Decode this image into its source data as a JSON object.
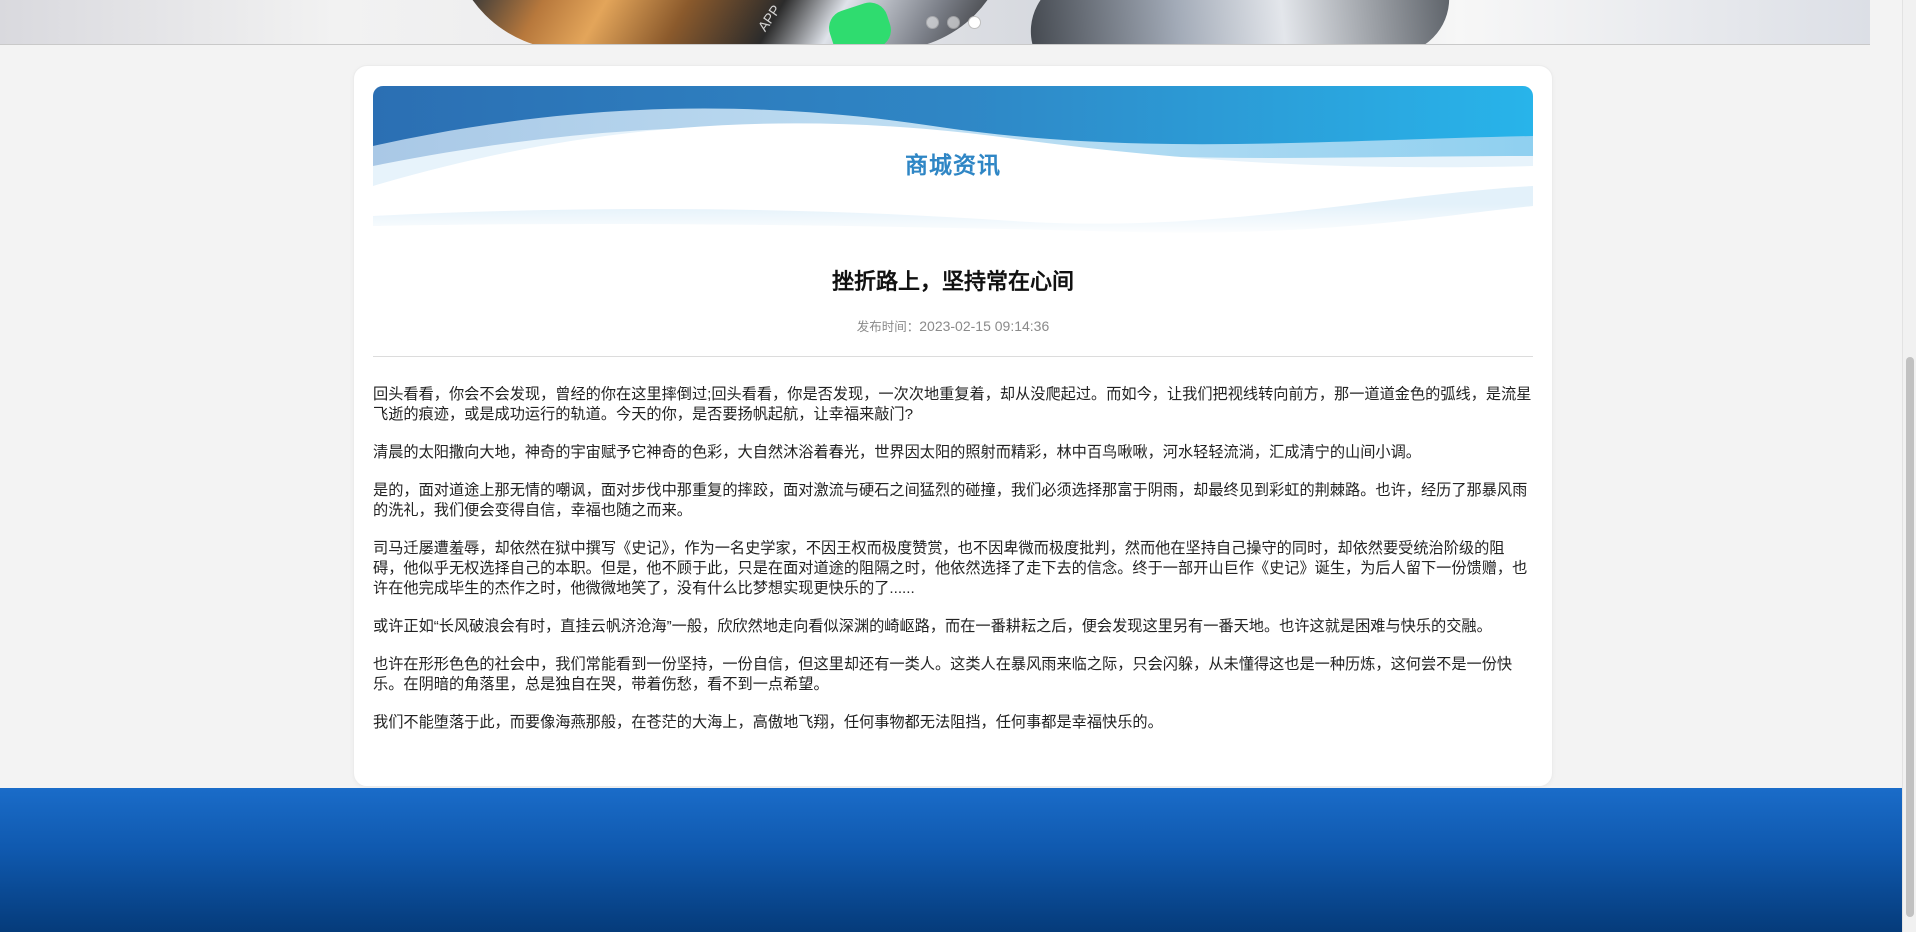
{
  "banner": {
    "app_text": "APP",
    "dots": [
      {
        "state": "inactive"
      },
      {
        "state": "inactive"
      },
      {
        "state": "active"
      }
    ]
  },
  "section": {
    "title": "商城资讯"
  },
  "article": {
    "title": "挫折路上，坚持常在心间",
    "publish_label": "发布时间：",
    "publish_time": "2023-02-15 09:14:36",
    "paragraphs": [
      "回头看看，你会不会发现，曾经的你在这里摔倒过;回头看看，你是否发现，一次次地重复着，却从没爬起过。而如今，让我们把视线转向前方，那一道道金色的弧线，是流星飞逝的痕迹，或是成功运行的轨道。今天的你，是否要扬帆起航，让幸福来敲门?",
      "清晨的太阳撒向大地，神奇的宇宙赋予它神奇的色彩，大自然沐浴着春光，世界因太阳的照射而精彩，林中百鸟啾啾，河水轻轻流淌，汇成清宁的山间小调。",
      "是的，面对道途上那无情的嘲讽，面对步伐中那重复的摔跤，面对激流与硬石之间猛烈的碰撞，我们必须选择那富于阴雨，却最终见到彩虹的荆棘路。也许，经历了那暴风雨的洗礼，我们便会变得自信，幸福也随之而来。",
      "司马迁屡遭羞辱，却依然在狱中撰写《史记》，作为一名史学家，不因王权而极度赞赏，也不因卑微而极度批判，然而他在坚持自己操守的同时，却依然要受统治阶级的阻碍，他似乎无权选择自己的本职。但是，他不顾于此，只是在面对道途的阻隔之时，他依然选择了走下去的信念。终于一部开山巨作《史记》诞生，为后人留下一份馈赠，也许在他完成毕生的杰作之时，他微微地笑了，没有什么比梦想实现更快乐的了......",
      "或许正如“长风破浪会有时，直挂云帆济沧海”一般，欣欣然地走向看似深渊的崎岖路，而在一番耕耘之后，便会发现这里另有一番天地。也许这就是困难与快乐的交融。",
      "也许在形形色色的社会中，我们常能看到一份坚持，一份自信，但这里却还有一类人。这类人在暴风雨来临之际，只会闪躲，从未懂得这也是一种历炼，这何尝不是一份快乐。在阴暗的角落里，总是独自在哭，带着伤愁，看不到一点希望。",
      "我们不能堕落于此，而要像海燕那般，在苍茫的大海上，高傲地飞翔，任何事物都无法阻挡，任何事都是幸福快乐的。"
    ]
  },
  "colors": {
    "header_title": "#2f86c5",
    "wave_dark": "#2b6fb3",
    "wave_light": "#9fd3f0",
    "footer_top": "#1a6cc9",
    "footer_bottom": "#053b7a"
  }
}
